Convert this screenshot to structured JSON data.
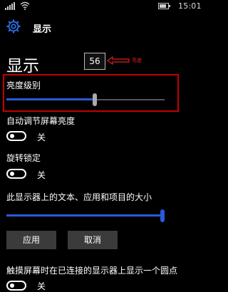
{
  "status_bar": {
    "time": "15:01"
  },
  "header": {
    "title": "显示",
    "settings_icon": "gear-icon"
  },
  "page": {
    "title": "显示"
  },
  "brightness": {
    "value": "56",
    "annotation_label": "亮度",
    "label": "亮度级别",
    "level_fraction": 0.56
  },
  "auto_brightness": {
    "label": "自动调节屏幕亮度",
    "state": "关"
  },
  "rotation_lock": {
    "label": "旋转锁定",
    "state": "关"
  },
  "text_size": {
    "label": "此显示器上的文本、应用和项目的大小",
    "level_fraction": 1.0
  },
  "buttons": {
    "apply": "应用",
    "cancel": "取消"
  },
  "tap_dots": {
    "label": "触摸屏幕时在已连接的显示器上显示一个圆点",
    "state": "关"
  },
  "colors": {
    "accent": "#2a5ad8",
    "annotation": "#e02020"
  }
}
